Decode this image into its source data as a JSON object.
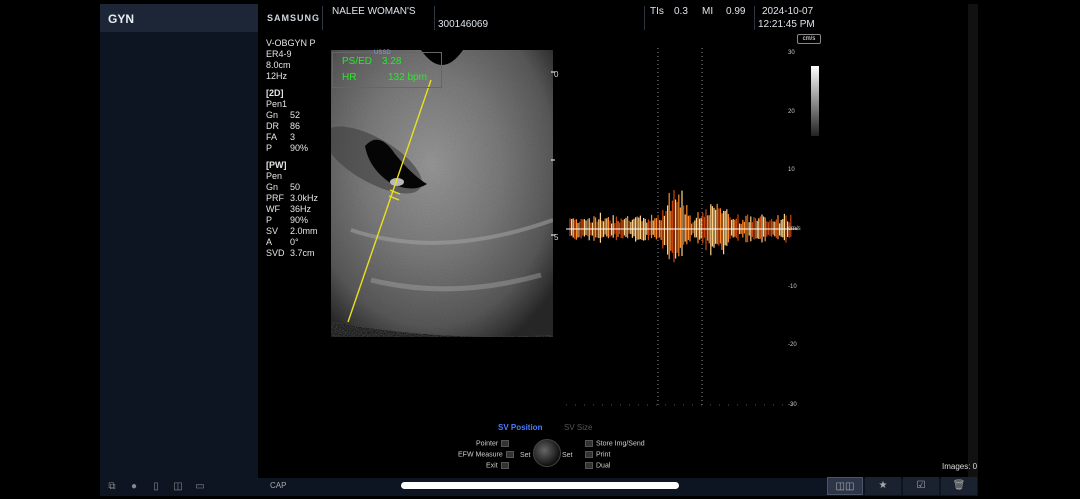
{
  "left_panel": {
    "title": "GYN"
  },
  "header": {
    "logo": "SAMSUNG",
    "hospital": "NALEE WOMAN'S",
    "patient_id": "300146069",
    "tis_label": "TIs",
    "tis_value": "0.3",
    "mi_label": "MI",
    "mi_value": "0.99",
    "date": "2024-10-07",
    "time": "12:21:45 PM"
  },
  "params": {
    "preset": "V-OBGYN P",
    "probe": "ER4-9",
    "depth": "8.0cm",
    "frame_rate": "12Hz",
    "section_2d": "[2D]",
    "pen_2d": "Pen1",
    "rows_2d": [
      {
        "k": "Gn",
        "v": "52"
      },
      {
        "k": "DR",
        "v": "86"
      },
      {
        "k": "FA",
        "v": "3"
      },
      {
        "k": "P",
        "v": "90%"
      }
    ],
    "section_pw": "[PW]",
    "pen_pw": "Pen",
    "rows_pw": [
      {
        "k": "Gn",
        "v": "50"
      },
      {
        "k": "PRF",
        "v": "3.0kHz"
      },
      {
        "k": "WF",
        "v": "36Hz"
      },
      {
        "k": "P",
        "v": "90%"
      },
      {
        "k": "SV",
        "v": "2.0mm"
      },
      {
        "k": "A",
        "v": "0°"
      },
      {
        "k": "SVD",
        "v": "3.7cm"
      }
    ]
  },
  "measure": {
    "ps_ed_label": "PS/ED",
    "ps_ed_value": "3.28",
    "hr_label": "HR",
    "hr_value": "132 bpm",
    "sub_label": "USSD"
  },
  "depth_marks": {
    "top": "0",
    "mid": "5"
  },
  "spectral_scale": [
    "30",
    "20",
    "10",
    "cm/s",
    "-10",
    "-20",
    "-30"
  ],
  "cm_icon": "cm/s",
  "controls": {
    "sv_position": "SV Position",
    "sv_size": "SV Size",
    "pointer": "Pointer",
    "efw_measure": "EFW Measure",
    "exit": "Exit",
    "set_left": "Set",
    "set_right": "Set",
    "store": "Store Img/Send",
    "print": "Print",
    "dual": "Dual"
  },
  "images_count": "Images: 0",
  "bottom": {
    "cap": "CAP"
  },
  "colors": {
    "accent_blue": "#4a7dff",
    "measure_green": "#2ee62e",
    "panel_bg": "#0d1522"
  }
}
